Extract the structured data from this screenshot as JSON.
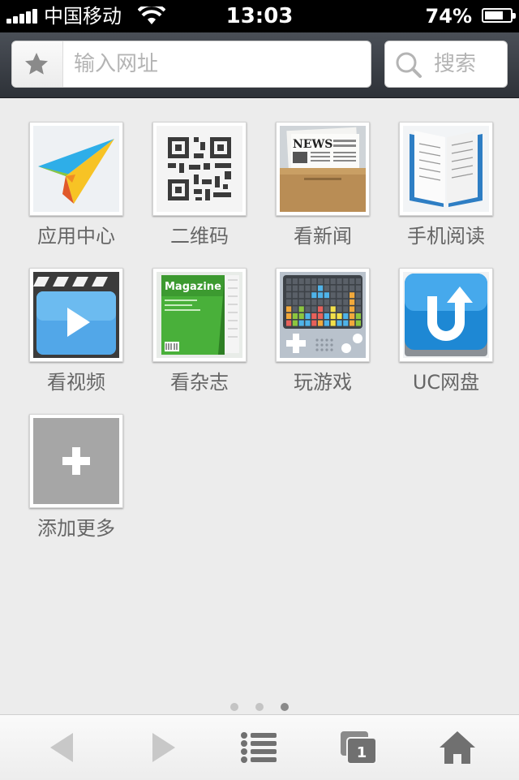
{
  "status_bar": {
    "carrier": "中国移动",
    "time": "13:03",
    "battery_percent": "74%",
    "battery_level": 0.74
  },
  "address_bar": {
    "url_placeholder": "输入网址",
    "search_placeholder": "搜索"
  },
  "apps": [
    {
      "label": "应用中心",
      "icon": "paper-plane-icon"
    },
    {
      "label": "二维码",
      "icon": "qr-code-icon"
    },
    {
      "label": "看新闻",
      "icon": "newspaper-icon"
    },
    {
      "label": "手机阅读",
      "icon": "book-icon"
    },
    {
      "label": "看视频",
      "icon": "video-clapper-icon"
    },
    {
      "label": "看杂志",
      "icon": "magazine-icon"
    },
    {
      "label": "玩游戏",
      "icon": "game-console-icon"
    },
    {
      "label": "UC网盘",
      "icon": "uc-cloud-drive-icon"
    },
    {
      "label": "添加更多",
      "icon": "plus-icon"
    }
  ],
  "app_icon_text": {
    "news": "NEWS",
    "magazine": "Magazine"
  },
  "page_indicator": {
    "count": 3,
    "active": 3
  },
  "bottom_bar": {
    "tab_count": "1"
  },
  "colors": {
    "background": "#ececec",
    "toolbar": "#3a3e45",
    "label": "#666666"
  }
}
